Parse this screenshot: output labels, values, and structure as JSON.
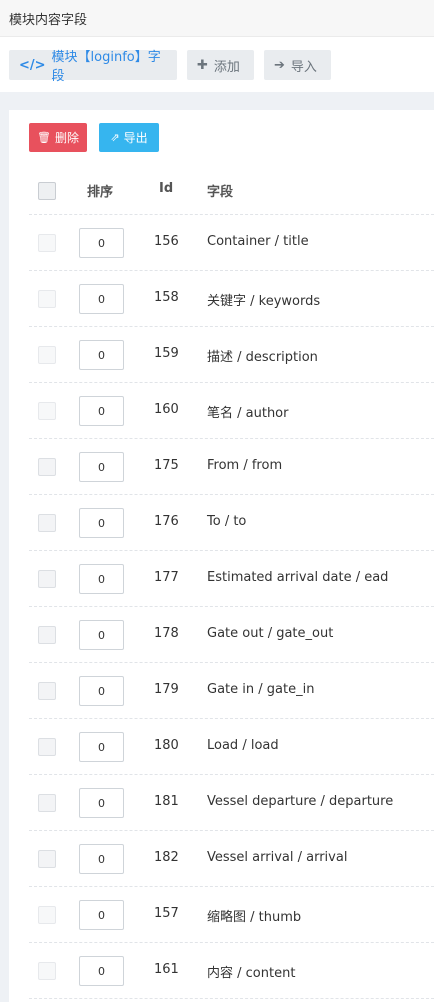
{
  "header": {
    "title": "模块内容字段"
  },
  "toolbar": {
    "module_icon": "</>",
    "module_label": "模块【loginfo】字段",
    "add_icon": "✚",
    "add_label": "添加",
    "import_icon": "➔",
    "import_label": "导入"
  },
  "bulk": {
    "delete_icon": "🗑",
    "delete_label": "删除",
    "export_icon": "⇗",
    "export_label": "导出"
  },
  "table": {
    "columns": {
      "sort": "排序",
      "id": "Id",
      "field": "字段"
    },
    "rows": [
      {
        "sort": "0",
        "id": "156",
        "field": "Container / title"
      },
      {
        "sort": "0",
        "id": "158",
        "field": "关键字 / keywords"
      },
      {
        "sort": "0",
        "id": "159",
        "field": "描述 / description"
      },
      {
        "sort": "0",
        "id": "160",
        "field": "笔名 / author"
      },
      {
        "sort": "0",
        "id": "175",
        "field": "From / from"
      },
      {
        "sort": "0",
        "id": "176",
        "field": "To / to"
      },
      {
        "sort": "0",
        "id": "177",
        "field": "Estimated arrival date / ead"
      },
      {
        "sort": "0",
        "id": "178",
        "field": "Gate out / gate_out"
      },
      {
        "sort": "0",
        "id": "179",
        "field": "Gate in / gate_in"
      },
      {
        "sort": "0",
        "id": "180",
        "field": "Load / load"
      },
      {
        "sort": "0",
        "id": "181",
        "field": "Vessel departure / departure"
      },
      {
        "sort": "0",
        "id": "182",
        "field": "Vessel arrival / arrival"
      },
      {
        "sort": "0",
        "id": "157",
        "field": "缩略图 / thumb"
      },
      {
        "sort": "0",
        "id": "161",
        "field": "内容 / content"
      }
    ]
  }
}
